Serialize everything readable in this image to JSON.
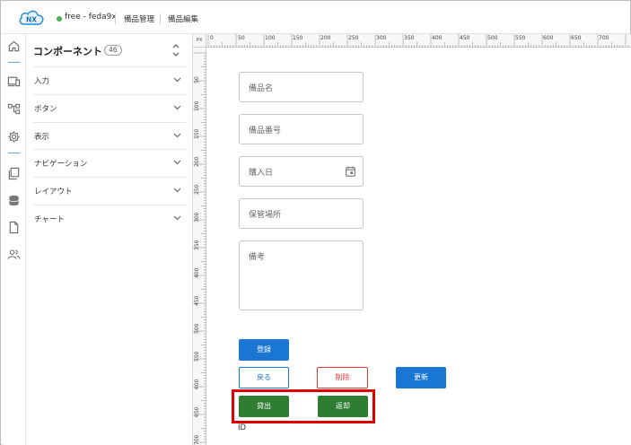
{
  "header": {
    "app_status": "free - feda9x",
    "breadcrumbs": [
      "備品管理",
      "備品編集"
    ],
    "logo_text": "NX",
    "status_color": "#4caf50"
  },
  "rail": {
    "icons": [
      "home-icon",
      "devices-icon",
      "flow-icon",
      "settings-icon",
      "pages-icon",
      "database-icon",
      "file-icon",
      "users-icon"
    ]
  },
  "panel": {
    "title": "コンポーネント",
    "count": "46",
    "items": [
      {
        "label": "入力"
      },
      {
        "label": "ボタン"
      },
      {
        "label": "表示"
      },
      {
        "label": "ナビゲーション"
      },
      {
        "label": "レイアウト"
      },
      {
        "label": "チャート"
      }
    ]
  },
  "ruler": {
    "unit": "PX",
    "top_labels": [
      "0",
      "50",
      "100",
      "150",
      "200",
      "250",
      "300",
      "350",
      "400",
      "450",
      "500",
      "550",
      "600",
      "650",
      "700"
    ],
    "left_labels": [
      "50",
      "100",
      "150",
      "200",
      "250",
      "300",
      "350",
      "400",
      "450",
      "500",
      "550",
      "600",
      "650",
      "700"
    ]
  },
  "form": {
    "fields": [
      {
        "placeholder": "備品名"
      },
      {
        "placeholder": "備品番号"
      },
      {
        "placeholder": "購入日"
      },
      {
        "placeholder": "保管場所"
      },
      {
        "placeholder": "備考"
      }
    ],
    "buttons": {
      "register": "登録",
      "back": "戻る",
      "delete": "削除",
      "update": "更新",
      "checkout": "貸出",
      "return": "返却"
    },
    "id_label": "ID"
  },
  "colors": {
    "primary": "#1976d2",
    "danger": "#e53935",
    "success": "#2e7d32",
    "highlight": "#e00000"
  }
}
